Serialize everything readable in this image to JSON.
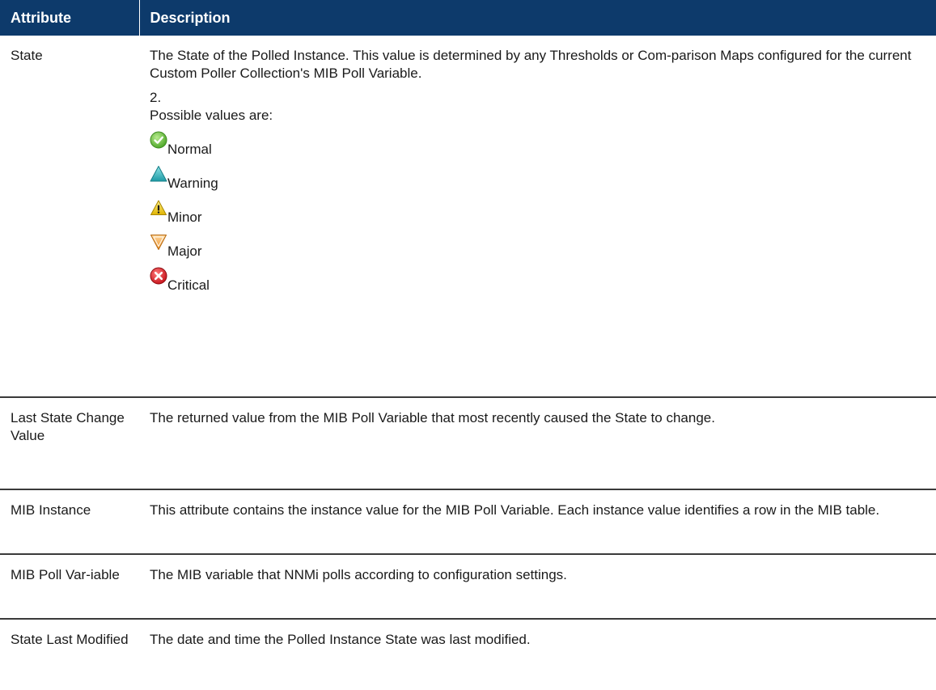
{
  "header": {
    "col_attribute": "Attribute",
    "col_description": "Description"
  },
  "rows": [
    {
      "attribute": "State",
      "description": "The State of the Polled Instance. This value is determined by any Thresholds or Com-parison Maps configured for the current Custom Poller Collection's MIB Poll Variable.",
      "note": "2.",
      "values_intro": "Possible values are:",
      "values": [
        {
          "label": "Normal",
          "icon": "normal-check-icon",
          "color": "#5cb82e"
        },
        {
          "label": "Warning",
          "icon": "warning-triangle-icon",
          "color": "#2ab0b8"
        },
        {
          "label": "Minor",
          "icon": "minor-exclamation-icon",
          "color": "#e8c20f"
        },
        {
          "label": "Major",
          "icon": "major-down-triangle-icon",
          "color": "#f0a640"
        },
        {
          "label": "Critical",
          "icon": "critical-x-icon",
          "color": "#d8222a"
        }
      ]
    },
    {
      "attribute": "Last State Change Value",
      "description": "The returned value from the MIB Poll Variable that most recently caused the State to change."
    },
    {
      "attribute": "MIB Instance",
      "description": "This attribute contains the instance value for the MIB Poll Variable. Each instance value identifies a row in the MIB table."
    },
    {
      "attribute": "MIB Poll Var-iable",
      "description": "The MIB variable that NNMi polls according to configuration settings."
    },
    {
      "attribute": "State Last Modified",
      "description": "The date and time the Polled Instance State was last modified."
    }
  ],
  "colors": {
    "header_bg": "#0d3a6b",
    "header_text": "#ffffff",
    "row_divider": "#3a3a3a"
  }
}
